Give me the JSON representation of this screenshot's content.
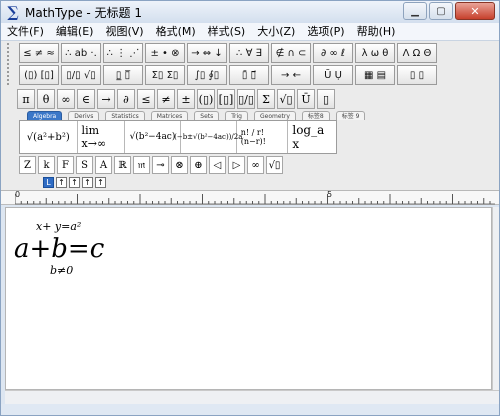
{
  "window": {
    "title": "MathType - 无标题 1",
    "app_icon": "sigma-icon",
    "controls": [
      "minimize-icon",
      "maximize-icon",
      "close-icon"
    ]
  },
  "menu": [
    "文件(F)",
    "编辑(E)",
    "视图(V)",
    "格式(M)",
    "样式(S)",
    "大小(Z)",
    "选项(P)",
    "帮助(H)"
  ],
  "toolbar_row1": [
    "≤ ≠ ≈",
    "∴ ab ·.",
    "∴ ⋮ ⋰",
    "± • ⊗",
    "→ ⇔ ↓",
    "∴ ∀ ∃",
    "∉ ∩ ⊂",
    "∂ ∞ ℓ",
    "λ ω θ",
    "Λ Ω Θ"
  ],
  "toolbar_row2": [
    "(▯) [▯]",
    "▯/▯ √▯",
    "▯̲ ▯̅",
    "Σ▯ Σ▯",
    "∫▯ ∮▯",
    "▯̄ ▯⃗",
    "→ ←",
    "Ū Ụ",
    "▦ ▤",
    "▯ ▯"
  ],
  "small_row": [
    "π",
    "θ",
    "∞",
    "∈",
    "→",
    "∂",
    "≤",
    "≠",
    "±",
    "(▯)",
    "[▯]",
    "▯/▯",
    "Σ",
    "√▯",
    "Ū",
    "▯"
  ],
  "tabs": [
    "Algebra",
    "Derivs",
    "Statistics",
    "Matrices",
    "Sets",
    "Trig",
    "Geometry",
    "标签8",
    "标签 9"
  ],
  "templates": [
    "√(a²+b²)",
    "lim x→∞",
    "√(b²−4ac)",
    "(−b±√(b²−4ac))/2a",
    "n! / r!(n−r)!",
    "log_a x"
  ],
  "greek_row": [
    "Z",
    "k",
    "F",
    "S",
    "A",
    "ℝ",
    "𝔪",
    "⊸",
    "⊗",
    "⊕",
    "◁",
    "▷",
    "∞",
    "√▯"
  ],
  "tabstops": [
    "L",
    "↑",
    "↑",
    "↑",
    "↑"
  ],
  "ruler": {
    "labels": [
      "0",
      "5"
    ]
  },
  "formula": {
    "over": "x+ y=a²",
    "main": "a+b=c",
    "under": "b≠0"
  },
  "colors": {
    "accent": "#3a77c8",
    "titlebar": "#dde6f1",
    "toolbar_bg": "#ebebeb"
  }
}
